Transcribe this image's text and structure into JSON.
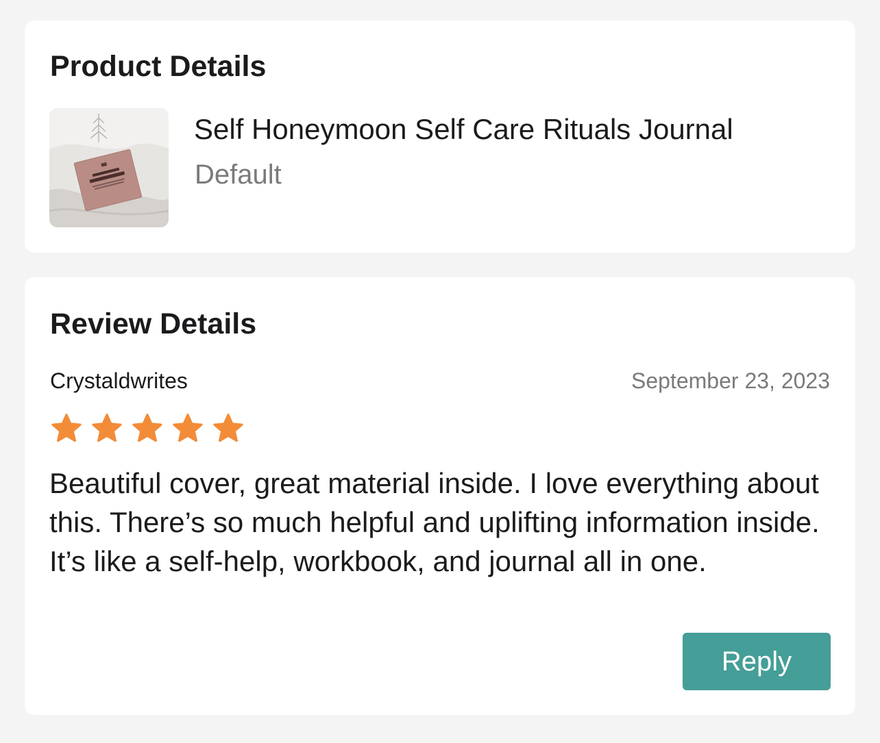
{
  "product_details": {
    "title": "Product Details",
    "product": {
      "name": "Self Honeymoon Self Care Rituals Journal",
      "variant": "Default",
      "image_alt": "product-thumbnail"
    }
  },
  "review_details": {
    "title": "Review Details",
    "reviewer": "Crystaldwrites",
    "date": "September 23, 2023",
    "rating": 5,
    "rating_max": 5,
    "body": "Beautiful cover, great material inside. I love everything about this. There’s so much helpful and uplifting information inside. It’s like a self-help, workbook, and journal all in one.",
    "reply_label": "Reply"
  },
  "colors": {
    "background": "#f4f4f5",
    "card": "#ffffff",
    "star": "#f28c38",
    "reply_button": "#459e97",
    "muted_text": "#7a7a7c"
  }
}
